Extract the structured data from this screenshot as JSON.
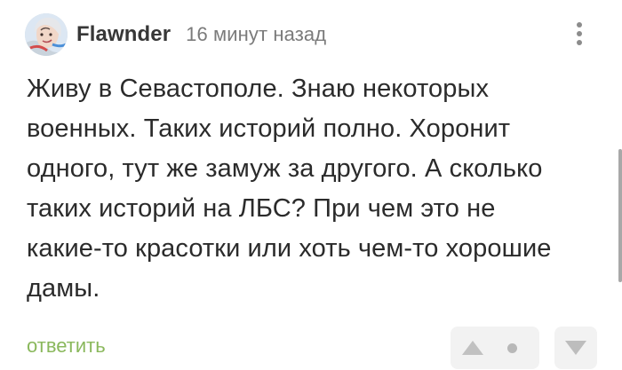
{
  "comment": {
    "author": "Flawnder",
    "time": "16 минут назад",
    "text": "Живу в Севастополе. Знаю некоторых военных. Таких историй полно. Хоронит одного, тут же замуж за другого. А сколько таких историй на ЛБС? При чем это не какие-то красотки или хоть чем-то хорошие дамы.",
    "reply_label": "ответить"
  },
  "icons": {
    "avatar": "avatar-icon",
    "more": "more-vertical-icon",
    "upvote": "upvote-icon",
    "rating": "rating-dot-icon",
    "downvote": "downvote-icon"
  },
  "colors": {
    "reply": "#8ab85c",
    "author": "#373737",
    "time": "#7b7b7b",
    "vote_background": "#f2f2f2",
    "vote_icon": "#c1c1c1"
  }
}
